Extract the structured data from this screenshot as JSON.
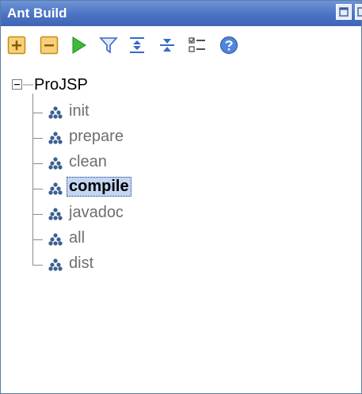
{
  "view": {
    "title": "Ant Build",
    "title_buttons": [
      {
        "icon": "maximize-icon"
      },
      {
        "icon": "restore-icon"
      }
    ]
  },
  "toolbar": {
    "buttons": [
      {
        "icon": "add-buildfile-icon",
        "color": "#e89a1a"
      },
      {
        "icon": "remove-buildfile-icon",
        "color": "#e89a1a"
      },
      {
        "icon": "run-icon",
        "color": "#2aa12a"
      },
      {
        "icon": "filter-icon",
        "color": "#3a68c8"
      },
      {
        "icon": "expand-all-icon",
        "color": "#3a68c8"
      },
      {
        "icon": "collapse-all-icon",
        "color": "#3a68c8"
      },
      {
        "icon": "properties-icon",
        "color": "#505050"
      },
      {
        "icon": "help-icon",
        "color": "#2a5bb8"
      }
    ]
  },
  "tree": {
    "root": {
      "label": "ProJSP",
      "expanded": true
    },
    "targets": [
      {
        "label": "init",
        "selected": false
      },
      {
        "label": "prepare",
        "selected": false
      },
      {
        "label": "clean",
        "selected": false
      },
      {
        "label": "compile",
        "selected": true
      },
      {
        "label": "javadoc",
        "selected": false
      },
      {
        "label": "all",
        "selected": false
      },
      {
        "label": "dist",
        "selected": false
      }
    ]
  },
  "colors": {
    "titlebar": "#4b73c3",
    "selection": "#c3d6f2",
    "target_text": "#6e6e6e"
  }
}
